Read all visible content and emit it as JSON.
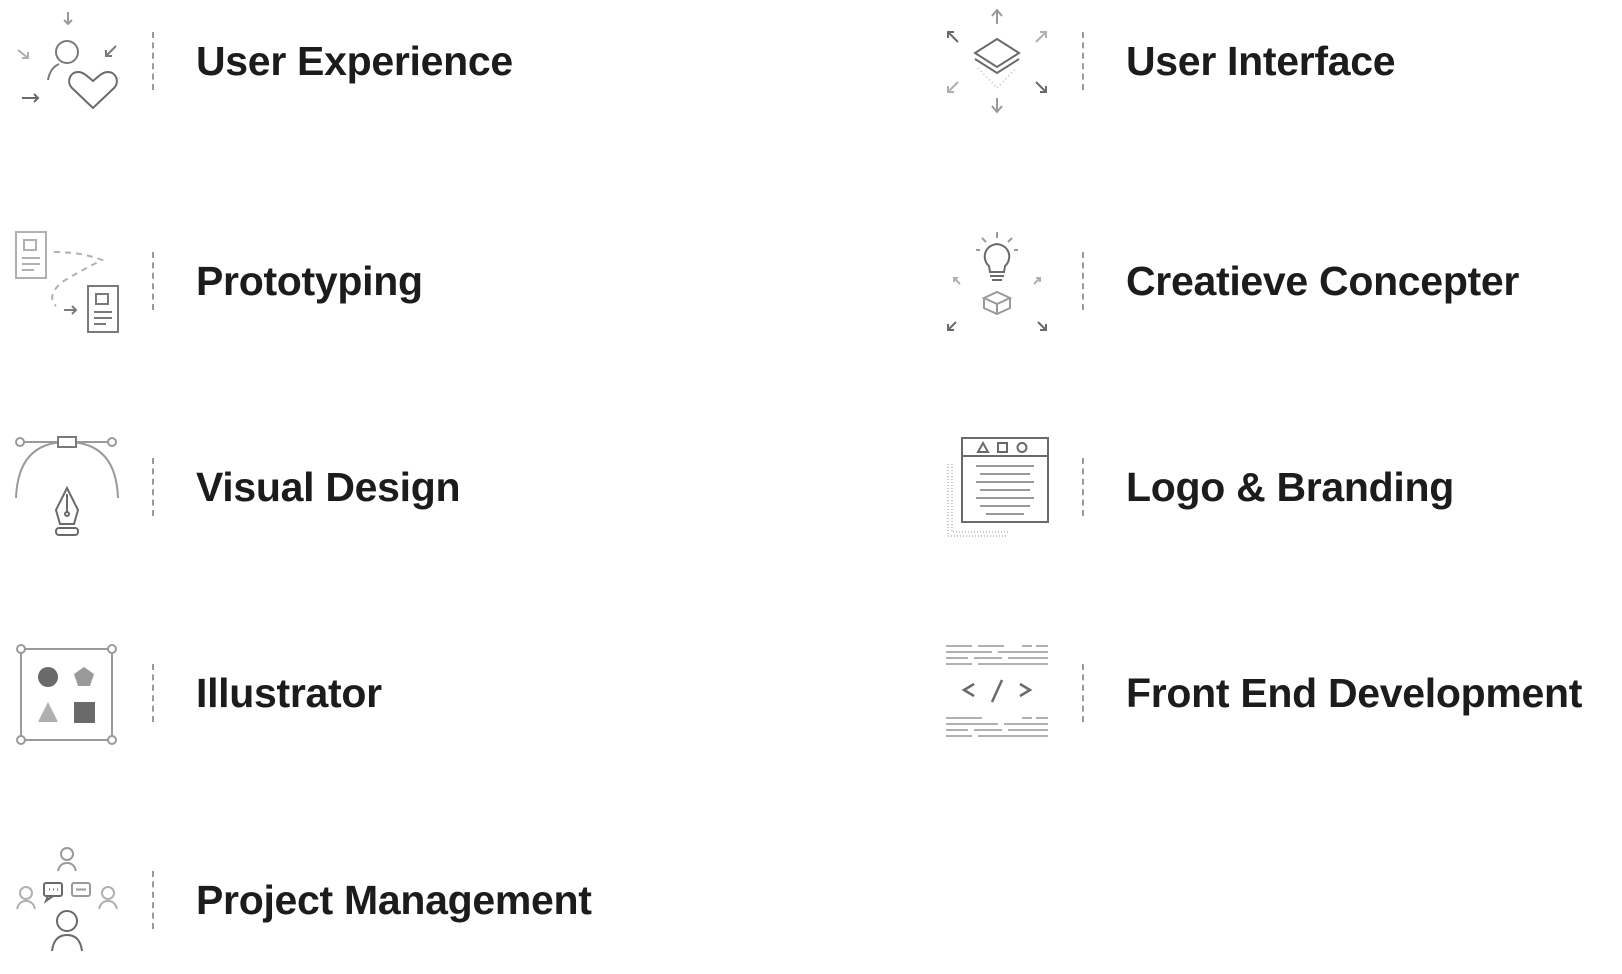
{
  "services": {
    "user_experience": {
      "label": "User Experience",
      "icon": "user-heart-icon"
    },
    "user_interface": {
      "label": "User Interface",
      "icon": "layers-icon"
    },
    "prototyping": {
      "label": "Prototyping",
      "icon": "prototype-flow-icon"
    },
    "creative_concept": {
      "label": "Creatieve Concepter",
      "icon": "lightbulb-box-icon"
    },
    "visual_design": {
      "label": "Visual Design",
      "icon": "pen-tool-icon"
    },
    "logo_branding": {
      "label": "Logo & Branding",
      "icon": "browser-window-icon"
    },
    "illustrator": {
      "label": "Illustrator",
      "icon": "shapes-icon"
    },
    "front_end": {
      "label": "Front End Development",
      "icon": "code-icon"
    },
    "project_management": {
      "label": "Project Management",
      "icon": "team-chat-icon"
    }
  },
  "colors": {
    "text": "#1c1c1c",
    "icon_stroke": "#7a7a7a",
    "icon_light": "#b0b0b0",
    "divider": "#9a9a9a"
  }
}
